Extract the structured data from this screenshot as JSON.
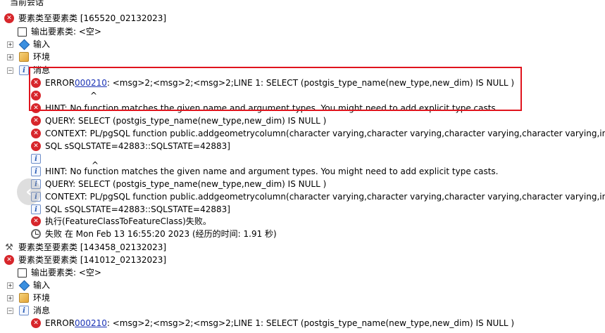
{
  "top_partial": "当前会话",
  "session1": {
    "title": "要素类至要素类 [165520_02132023]",
    "output_label": "输出要素类: <空>",
    "input_label": "输入",
    "env_label": "环境",
    "messages_label": "消息",
    "expand_plus": "+",
    "expand_minus": "−",
    "error_prefix": "ERROR ",
    "error_code": "000210",
    "error_text": ": <msg>2;<msg>2;<msg>2;LINE 1: SELECT (postgis_type_name(new_type,new_dim) IS NULL )",
    "caret": "^",
    "hint": "HINT:  No function matches the given name and argument types. You might need to add explicit type casts.",
    "query": "QUERY:  SELECT (postgis_type_name(new_type,new_dim) IS NULL )",
    "context": "CONTEXT:  PL/pgSQL function public.addgeometrycolumn(character varying,character varying,character varying,character varying,integer",
    "sqlstate": "SQL sSQLSTATE=42883::SQLSTATE=42883]",
    "info_hint": "HINT:  No function matches the given name and argument types. You might need to add explicit type casts.",
    "info_query": "QUERY:  SELECT (postgis_type_name(new_type,new_dim) IS NULL )",
    "info_context": "CONTEXT:  PL/pgSQL function public.addgeometrycolumn(character varying,character varying,character varying,character varying,integer",
    "info_sqlstate": "SQL sSQLSTATE=42883::SQLSTATE=42883]",
    "exec_failed": "执行(FeatureClassToFeatureClass)失败。",
    "failed_time": "失败 在 Mon Feb 13 16:55:20 2023 (经历的时间: 1.91 秒)"
  },
  "session2": {
    "title": "要素类至要素类 [143458_02132023]"
  },
  "session3": {
    "title": "要素类至要素类 [141012_02132023]",
    "output_label": "输出要素类: <空>",
    "input_label": "输入",
    "env_label": "环境",
    "messages_label": "消息",
    "error_prefix": "ERROR ",
    "error_code": "000210",
    "error_text": ": <msg>2;<msg>2;<msg>2;LINE 1: SELECT (postgis_type_name(new_type,new_dim) IS NULL )"
  },
  "scroll_glyph": "‹",
  "icons": [
    "error-icon",
    "info-icon",
    "checkbox-icon",
    "input-diamond-icon",
    "environment-icon",
    "clock-icon",
    "hammer-icon"
  ]
}
